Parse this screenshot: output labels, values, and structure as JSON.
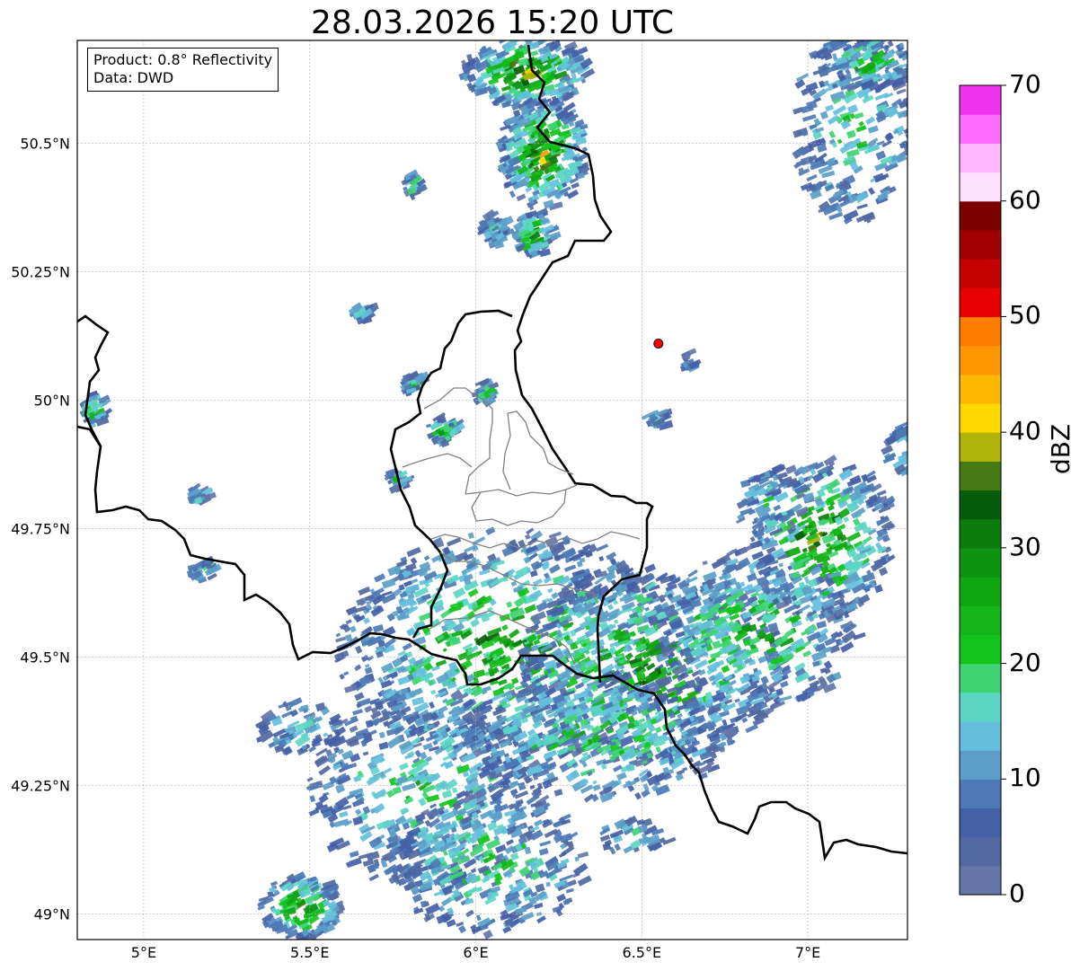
{
  "title": "28.03.2026 15:20 UTC",
  "info": {
    "product": "Product: 0.8° Reflectivity",
    "data": "Data: DWD"
  },
  "map_extent": {
    "lon_min": 4.8,
    "lon_max": 7.3,
    "lat_min": 48.95,
    "lat_max": 50.7
  },
  "lat_ticks": [
    {
      "value": 50.5,
      "label": "50.5°N"
    },
    {
      "value": 50.25,
      "label": "50.25°N"
    },
    {
      "value": 50.0,
      "label": "50°N"
    },
    {
      "value": 49.75,
      "label": "49.75°N"
    },
    {
      "value": 49.5,
      "label": "49.5°N"
    },
    {
      "value": 49.25,
      "label": "49.25°N"
    },
    {
      "value": 49.0,
      "label": "49°N"
    }
  ],
  "lon_ticks": [
    {
      "value": 5.0,
      "label": "5°E"
    },
    {
      "value": 5.5,
      "label": "5.5°E"
    },
    {
      "value": 6.0,
      "label": "6°E"
    },
    {
      "value": 6.5,
      "label": "6.5°E"
    },
    {
      "value": 7.0,
      "label": "7°E"
    }
  ],
  "radar_site": {
    "lon": 6.55,
    "lat": 50.11,
    "color": "#ff0000"
  },
  "colorbar": {
    "label": "dBZ",
    "min": 0,
    "max": 70,
    "tick_labels": [
      "0",
      "10",
      "20",
      "30",
      "40",
      "50",
      "60",
      "70"
    ],
    "colors": [
      "#6576a8",
      "#5369a0",
      "#4460a6",
      "#4d7ab4",
      "#5c9ec8",
      "#64bfdc",
      "#5cd6c4",
      "#3ed472",
      "#12c41c",
      "#12b618",
      "#10a612",
      "#0e9410",
      "#0c7c0e",
      "#065c08",
      "#467814",
      "#aeb40a",
      "#ffd800",
      "#ffb800",
      "#ff9800",
      "#ff7c00",
      "#e80000",
      "#c40000",
      "#a00000",
      "#7c0000",
      "#ffe0ff",
      "#ffb8ff",
      "#ff6cff",
      "#ee32ee"
    ]
  }
}
